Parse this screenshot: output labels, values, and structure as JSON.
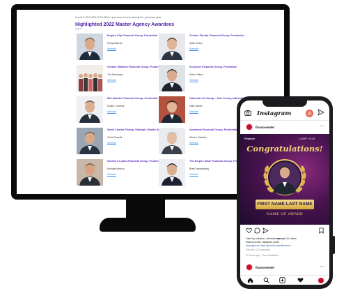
{
  "desktop": {
    "intro_text": "levels in $10,800,000 USD in premium levels during the previous year.",
    "heading": "Highlighted 2022 Master Agency Awardees",
    "website_label": "Website",
    "agencies": [
      {
        "name": "Empire City Financial Group, Prudential",
        "person": "Rony Mahrez"
      },
      {
        "name": "Greater Florida Financial Group, Prudential",
        "person": "Mark Sears"
      },
      {
        "name": "Greater Midwest Financial Group, Prudential",
        "person": "Tim Stavinsky"
      },
      {
        "name": "Keystone Financial Group, Prudential",
        "person": "Peter Valent"
      },
      {
        "name": "Mid Atlantic Financial Group, Prudential",
        "person": "Dustin Cornelis"
      },
      {
        "name": "National Life Group – New Jersey, National Life",
        "person": "Mike Martin"
      },
      {
        "name": "North Central Florida, Strategic Wealth Specialist",
        "person": "Chris Russell"
      },
      {
        "name": "Northeast Financial Group, Prudential",
        "person": "Steven Stretton"
      },
      {
        "name": "Northern Lights Financial Group, Prudential",
        "person": "Michael Nelson"
      },
      {
        "name": "The Empire State Financial Group, Prudential",
        "person": "Brett Yamashamy"
      }
    ]
  },
  "phone": {
    "app_logo": "Instagram",
    "account": "financecenter",
    "post": {
      "brand": "Finance",
      "event": "LAMP 2024",
      "congrats": "Congratulations!",
      "banner_name": "FIRST NAME  LAST NAME",
      "award": "NAME OF AWARD"
    },
    "caption": {
      "likes": "Liked by fullname, otherfullname and 10 others",
      "text": "finance.center instagram posts",
      "tags": "#springboard #spring #welcomedifference",
      "comments": "View All 12 Comments",
      "time": "12 hours ago · See translation"
    },
    "second_post_account": "financecenter"
  },
  "colors": {
    "heading": "#4b1fa6",
    "agency_name": "#5b2cc4",
    "link": "#3b8fe8",
    "gold": "#f4d279",
    "brand_red": "#c8102e"
  },
  "icons": {
    "camera": "camera-icon",
    "send": "send-icon",
    "like": "heart-icon",
    "comment": "comment-icon",
    "share": "share-icon",
    "save": "bookmark-icon",
    "home": "home-icon",
    "search": "search-icon",
    "add": "add-post-icon",
    "activity": "heart-icon"
  }
}
